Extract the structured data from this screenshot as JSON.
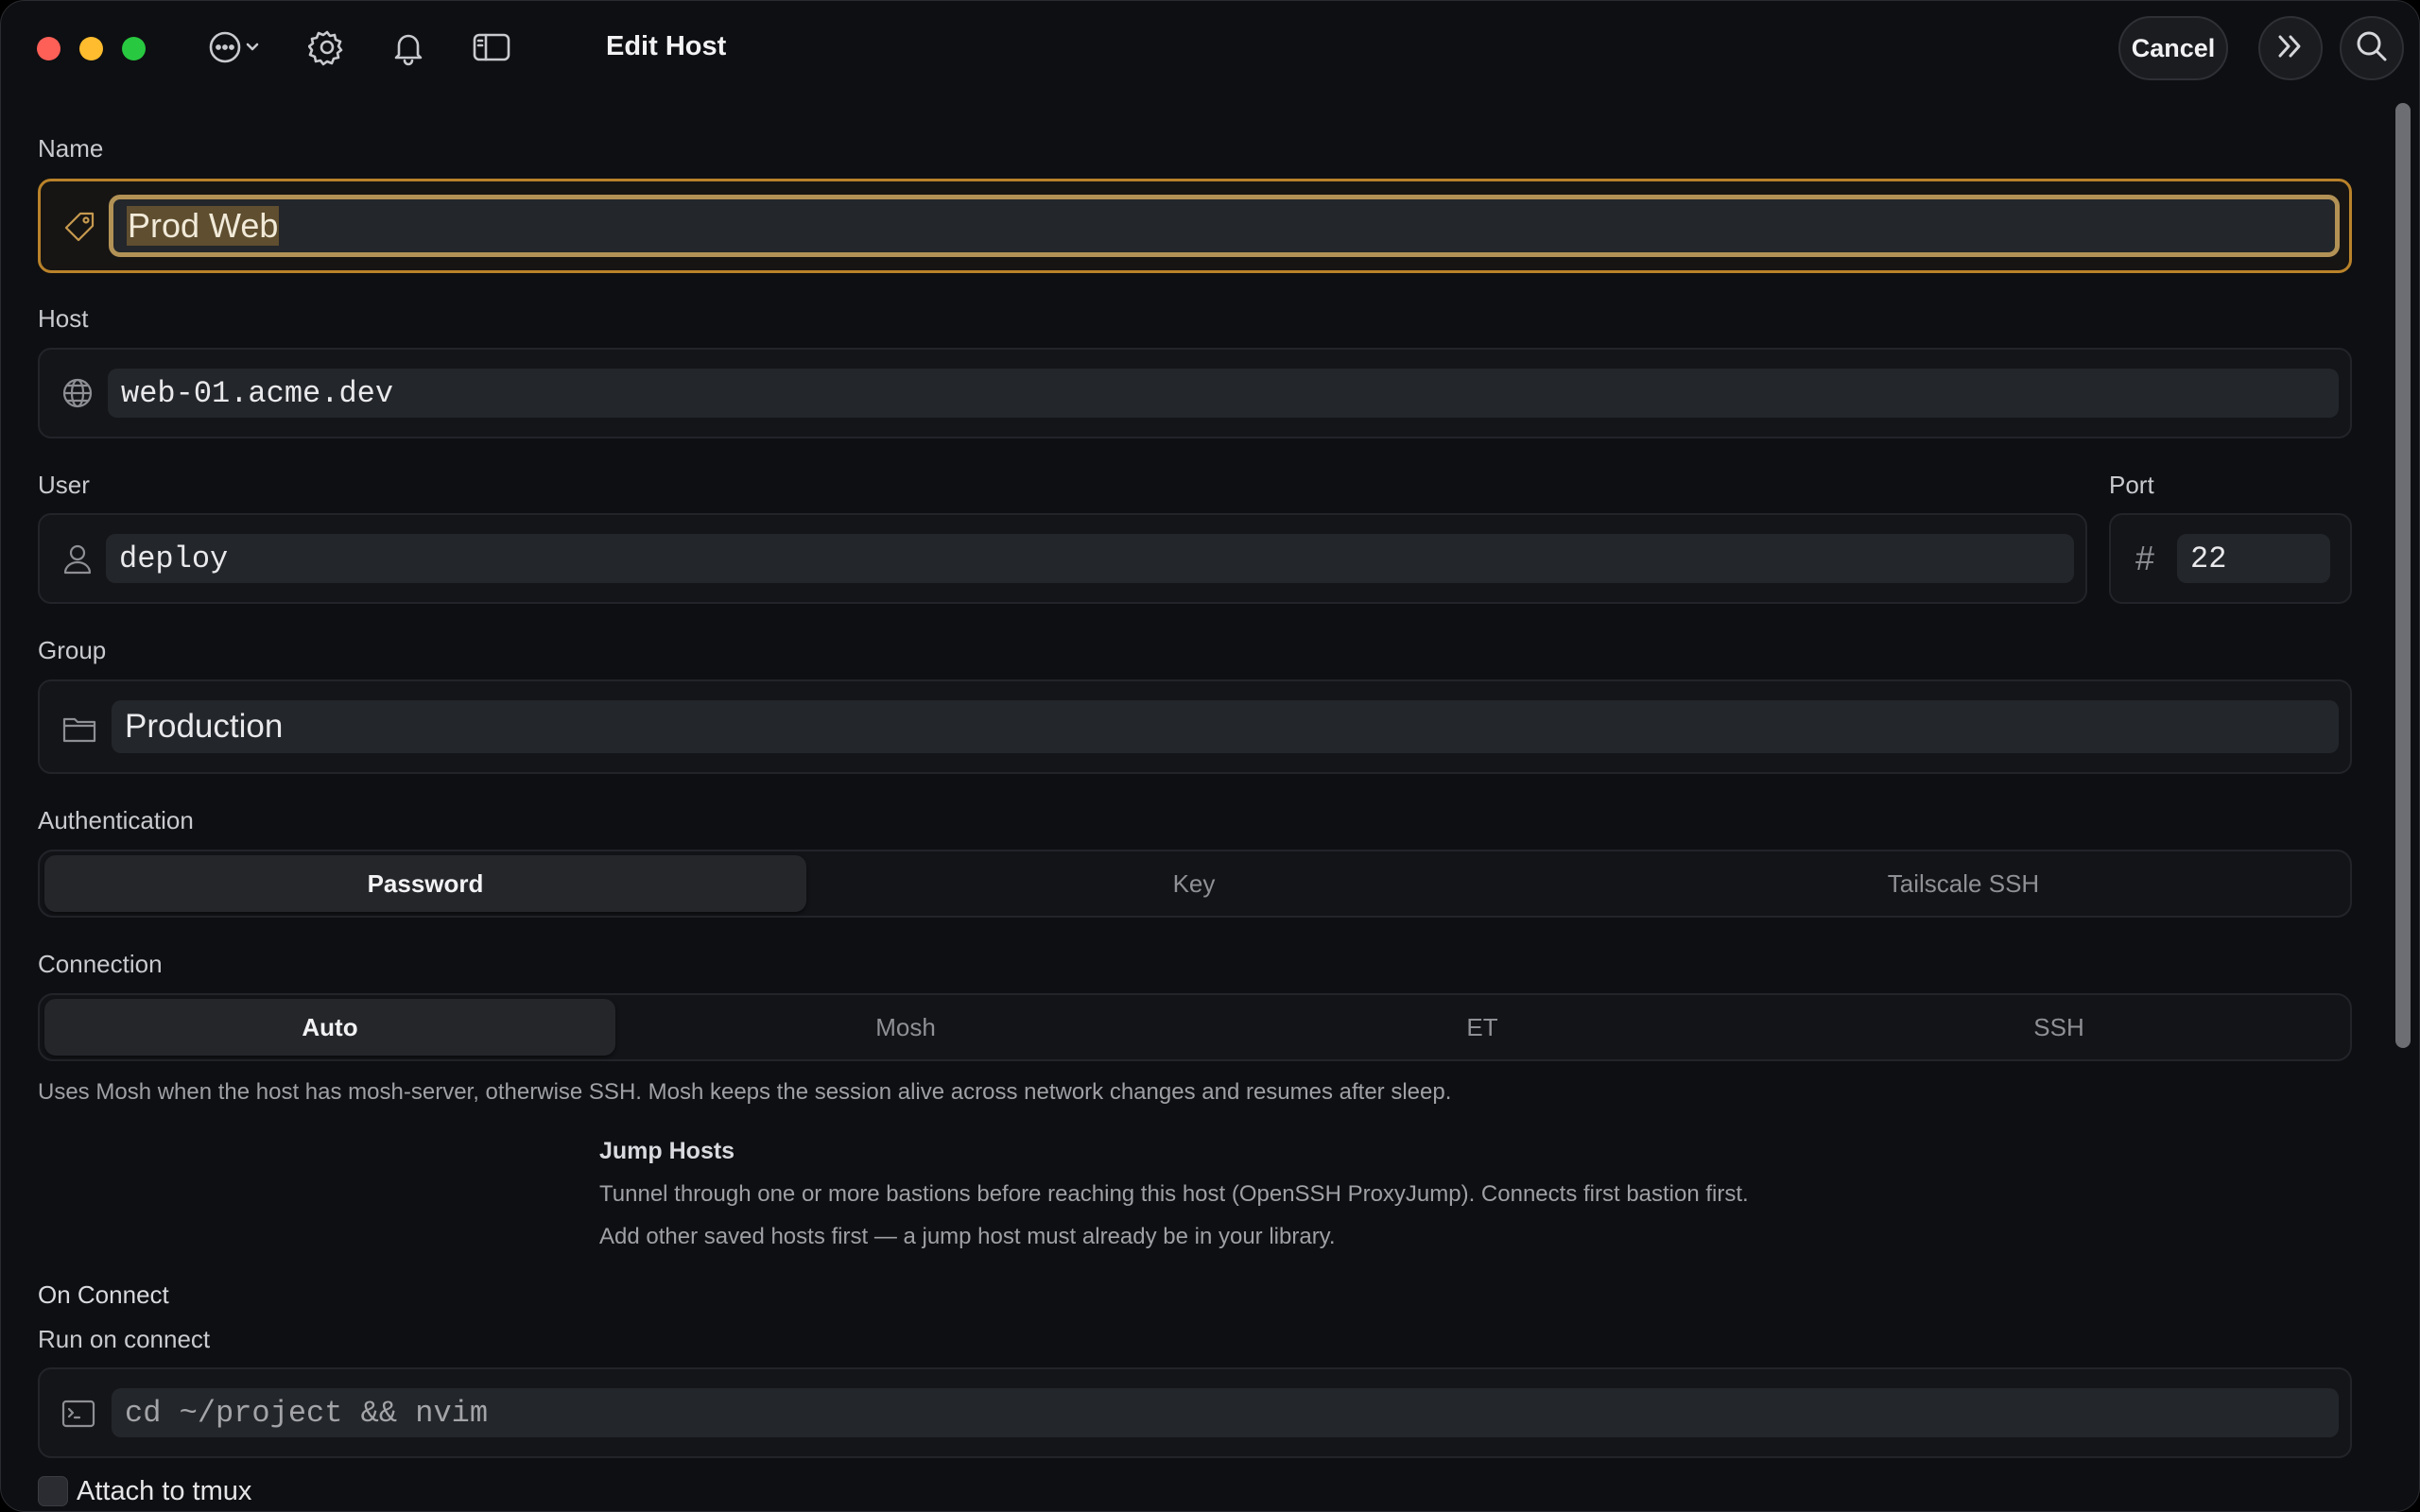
{
  "window": {
    "title": "Edit Host",
    "cancel_label": "Cancel"
  },
  "toolbar_icons": [
    "more-icon",
    "gear-icon",
    "bell-icon",
    "sidebar-icon",
    "forward-icon",
    "search-icon"
  ],
  "form": {
    "name": {
      "label": "Name",
      "value": "Prod Web",
      "icon": "tag-icon"
    },
    "host": {
      "label": "Host",
      "value": "web-01.acme.dev",
      "icon": "globe-icon"
    },
    "user": {
      "label": "User",
      "value": "deploy",
      "icon": "person-icon"
    },
    "port": {
      "label": "Port",
      "value": "22",
      "icon_glyph": "#"
    },
    "group": {
      "label": "Group",
      "value": "Production",
      "icon": "folder-icon"
    },
    "authentication": {
      "label": "Authentication",
      "options": [
        "Password",
        "Key",
        "Tailscale SSH"
      ],
      "selected": "Password"
    },
    "connection": {
      "label": "Connection",
      "options": [
        "Auto",
        "Mosh",
        "ET",
        "SSH"
      ],
      "selected": "Auto",
      "help": "Uses Mosh when the host has mosh-server, otherwise SSH. Mosh keeps the session alive across network changes and resumes after sleep."
    },
    "jump_hosts": {
      "title": "Jump Hosts",
      "description": "Tunnel through one or more bastions before reaching this host (OpenSSH ProxyJump). Connects first bastion first.",
      "empty_note": "Add other saved hosts first — a jump host must already be in your library."
    },
    "on_connect": {
      "title": "On Connect",
      "run_label": "Run on connect",
      "run_placeholder": "cd ~/project && nvim",
      "attach_tmux_label": "Attach to tmux",
      "attach_tmux_checked": false
    }
  },
  "colors": {
    "focus_ring": "#b9822a",
    "window_bg": "#0e0f12"
  }
}
